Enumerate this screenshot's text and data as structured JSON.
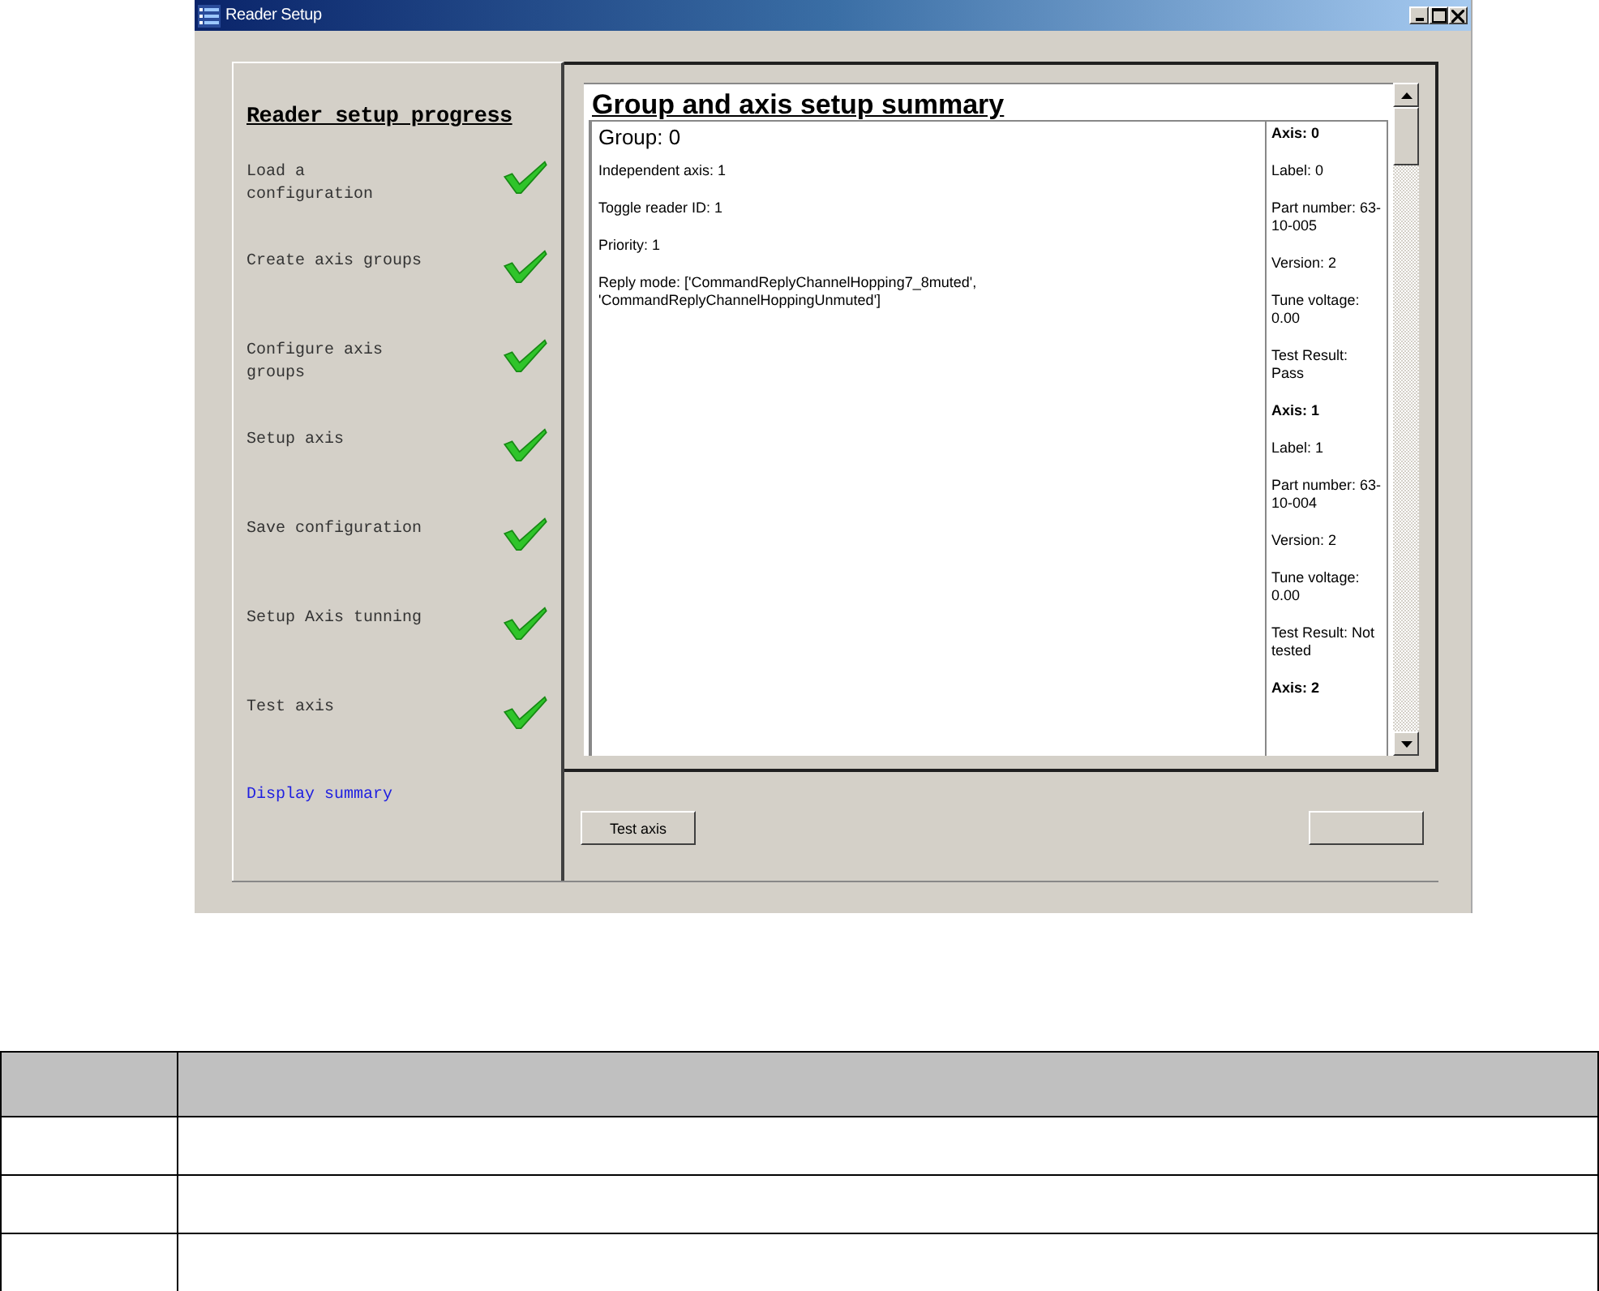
{
  "window": {
    "title": "Reader Setup"
  },
  "progress": {
    "title": "Reader setup progress",
    "steps": [
      {
        "label": "Load a configuration",
        "done": true
      },
      {
        "label": "Create axis groups",
        "done": true
      },
      {
        "label": "Configure axis groups",
        "done": true
      },
      {
        "label": "Setup axis",
        "done": true
      },
      {
        "label": "Save configuration",
        "done": true
      },
      {
        "label": "Setup Axis tunning",
        "done": true
      },
      {
        "label": "Test axis",
        "done": true
      }
    ],
    "link": "Display summary"
  },
  "summary": {
    "title": "Group and axis setup summary",
    "group": {
      "heading": "Group: 0",
      "lines": [
        "Independent axis: 1",
        "Toggle reader ID: 1",
        "Priority: 1",
        "Reply mode: ['CommandReplyChannelHopping7_8muted', 'CommandReplyChannelHoppingUnmuted']"
      ]
    },
    "axes": [
      {
        "heading": "Axis: 0",
        "lines": [
          "Label: 0",
          "Part number: 63-10-005",
          "Version: 2",
          "Tune voltage: 0.00",
          "Test Result: Pass"
        ]
      },
      {
        "heading": "Axis: 1",
        "lines": [
          "Label: 1",
          "Part number: 63-10-004",
          "Version: 2",
          "Tune voltage: 0.00",
          "Test Result: Not tested"
        ]
      },
      {
        "heading": "Axis: 2"
      }
    ]
  },
  "buttons": [
    {
      "kind": "labeled",
      "label": "Test axis"
    },
    {
      "kind": "blank"
    }
  ]
}
